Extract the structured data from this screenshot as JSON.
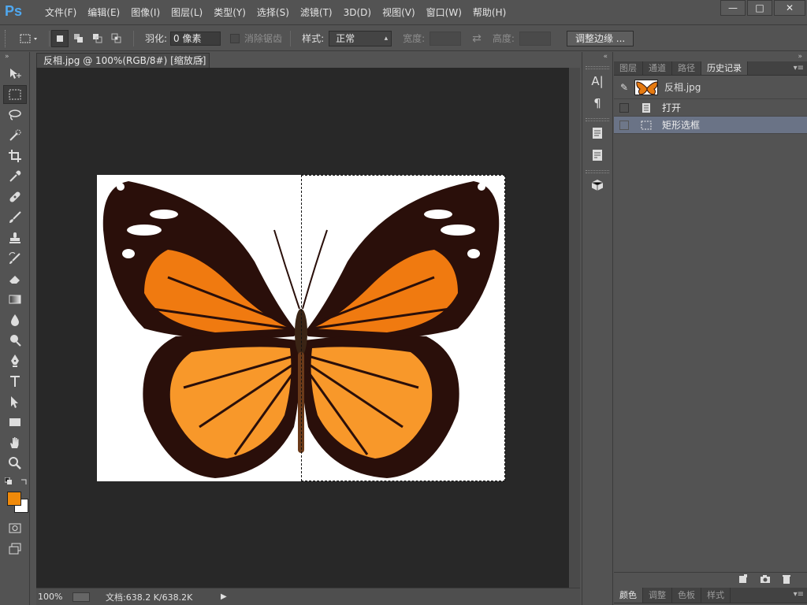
{
  "app": {
    "logo": "Ps"
  },
  "menu": [
    "文件(F)",
    "编辑(E)",
    "图像(I)",
    "图层(L)",
    "类型(Y)",
    "选择(S)",
    "滤镜(T)",
    "3D(D)",
    "视图(V)",
    "窗口(W)",
    "帮助(H)"
  ],
  "window_buttons": {
    "minimize": "—",
    "maximize": "□",
    "close": "✕"
  },
  "options": {
    "feather_label": "羽化:",
    "feather_value": "0 像素",
    "antialias_label": "消除锯齿",
    "style_label": "样式:",
    "style_value": "正常",
    "width_label": "宽度:",
    "height_label": "高度:",
    "refine_edge": "调整边缘 ..."
  },
  "document": {
    "tab_title": "反相.jpg @ 100%(RGB/8#) [缩放后]",
    "close": "✕"
  },
  "status": {
    "zoom": "100%",
    "doc_info": "文档:638.2 K/638.2K"
  },
  "toolbar": {
    "head": "»",
    "tools": [
      "move-tool",
      "rect-marquee-tool",
      "lasso-tool",
      "quick-select-tool",
      "crop-tool",
      "eyedropper-tool",
      "spot-heal-tool",
      "brush-tool",
      "clone-stamp-tool",
      "history-brush-tool",
      "eraser-tool",
      "gradient-tool",
      "blur-tool",
      "dodge-tool",
      "pen-tool",
      "type-tool",
      "path-select-tool",
      "rectangle-tool",
      "hand-tool",
      "zoom-tool"
    ],
    "foreground_color": "#f08a0a",
    "background_color": "#ffffff"
  },
  "midstrip": {
    "head": "«",
    "type_glyph": "A|",
    "para_glyph": "¶"
  },
  "right_panel": {
    "head": "»",
    "tabs": [
      "图层",
      "通道",
      "路径",
      "历史记录"
    ],
    "active_tab": "历史记录",
    "snapshot_name": "反相.jpg",
    "history": [
      {
        "label": "打开",
        "selected": false
      },
      {
        "label": "矩形选框",
        "selected": true
      }
    ],
    "bottom_tabs": [
      "颜色",
      "调整",
      "色板",
      "样式"
    ],
    "active_bottom_tab": "颜色"
  }
}
